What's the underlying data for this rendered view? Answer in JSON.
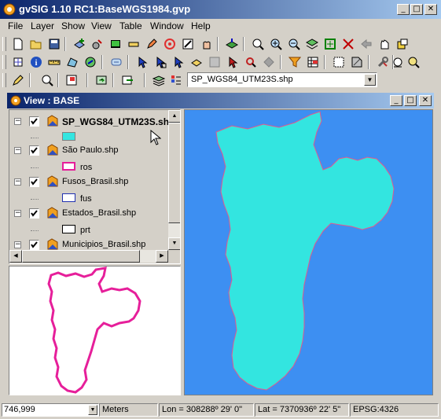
{
  "window": {
    "title": "gvSIG 1.10 RC1:BaseWGS1984.gvp",
    "controls": {
      "minimize": "_",
      "maximize": "□",
      "close": "✕"
    }
  },
  "menu": [
    "File",
    "Layer",
    "Show",
    "View",
    "Table",
    "Window",
    "Help"
  ],
  "toolbar": {
    "layer_combo_value": "SP_WGS84_UTM23S.shp"
  },
  "view": {
    "title": "View : BASE"
  },
  "toc": {
    "layers": [
      {
        "name": "SP_WGS84_UTM23S.shp",
        "checked": true,
        "selected": true,
        "symbol_label": "",
        "symbol_fill": "#33e5e0",
        "symbol_stroke": "#808080"
      },
      {
        "name": "São Paulo.shp",
        "checked": true,
        "selected": false,
        "symbol_label": "ros",
        "symbol_fill": "#ffffff",
        "symbol_stroke": "#e61f9a"
      },
      {
        "name": "Fusos_Brasil.shp",
        "checked": true,
        "selected": false,
        "symbol_label": "fus",
        "symbol_fill": "#ffffff",
        "symbol_stroke": "#2030b0"
      },
      {
        "name": "Estados_Brasil.shp",
        "checked": true,
        "selected": false,
        "symbol_label": "prt",
        "symbol_fill": "#ffffff",
        "symbol_stroke": "#000000"
      },
      {
        "name": "Municipios_Brasil.shp",
        "checked": true,
        "selected": false
      }
    ]
  },
  "map": {
    "background": "#3d8ff2",
    "fill": "#33e5e0",
    "outline": "#e25a8c"
  },
  "overview": {
    "outline": "#e61f9a"
  },
  "status": {
    "scale": "746,999",
    "units": "Meters",
    "lon": "Lon = 308288º 29' 0\"",
    "lat": "Lat = 7370936º 22' 5\"",
    "epsg": "EPSG:4326"
  }
}
